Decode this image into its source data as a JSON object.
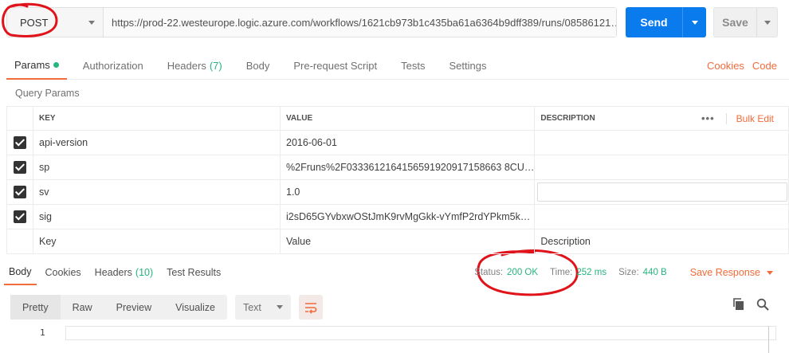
{
  "request": {
    "method": "POST",
    "url": "https://prod-22.westeurope.logic.azure.com/workflows/1621cb973b1c435ba61a6364b9dff389/runs/08586121…",
    "send_label": "Send",
    "save_label": "Save"
  },
  "tabs": [
    {
      "label": "Params"
    },
    {
      "label": "Authorization"
    },
    {
      "label": "Headers",
      "count": "(7)"
    },
    {
      "label": "Body"
    },
    {
      "label": "Pre-request Script"
    },
    {
      "label": "Tests"
    },
    {
      "label": "Settings"
    }
  ],
  "right_links": {
    "cookies": "Cookies",
    "code": "Code"
  },
  "query_params": {
    "title": "Query Params",
    "headers": {
      "key": "KEY",
      "value": "VALUE",
      "description": "DESCRIPTION"
    },
    "more": "•••",
    "bulk_edit": "Bulk Edit",
    "rows": [
      {
        "key": "api-version",
        "value": "2016-06-01",
        "checked": true
      },
      {
        "key": "sp",
        "value": "%2Fruns%2F0333612164156591920917158663 8CU…",
        "checked": true
      },
      {
        "key": "sv",
        "value": "1.0",
        "checked": true
      },
      {
        "key": "sig",
        "value": "i2sD65GYvbxwOStJmK9rvMgGkk-vYmfP2rdYPkm5k…",
        "checked": true
      }
    ],
    "placeholders": {
      "key": "Key",
      "value": "Value",
      "description": "Description"
    }
  },
  "response": {
    "tabs": [
      {
        "label": "Body"
      },
      {
        "label": "Cookies"
      },
      {
        "label": "Headers",
        "count": "(10)"
      },
      {
        "label": "Test Results"
      }
    ],
    "status_label": "Status:",
    "status_value": "200 OK",
    "time_label": "Time:",
    "time_value": "252 ms",
    "size_label": "Size:",
    "size_value": "440 B",
    "save_response": "Save Response",
    "views": [
      "Pretty",
      "Raw",
      "Preview",
      "Visualize"
    ],
    "format": "Text",
    "line_number": "1"
  },
  "colors": {
    "accent": "#f26b3a",
    "send": "#097bed",
    "success": "#26b47f",
    "annotation": "#e0121a"
  }
}
